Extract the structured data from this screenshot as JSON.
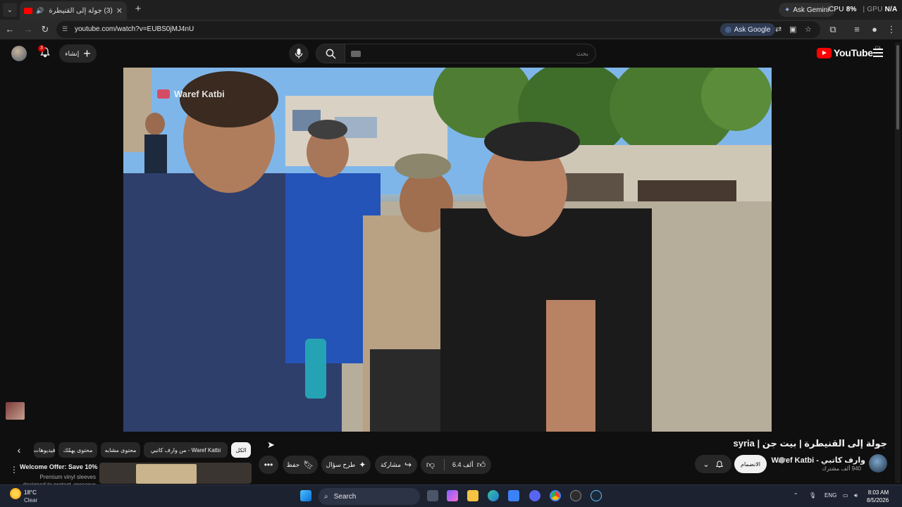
{
  "browser": {
    "tab_title": "(3) جولة إلى القنيطرة | بيت ...",
    "new_tab": "+",
    "ask_gemini": "Ask Gemini",
    "cpu_label": "CPU",
    "cpu_value": "8%",
    "gpu_value": "N/A",
    "url": "youtube.com/watch?v=EUBS0jMJ4nU",
    "ask_google": "Ask Google"
  },
  "youtube": {
    "notification_count": "3",
    "create_label": "إنشاء",
    "search_placeholder": "بحث",
    "logo_text": "YouTube",
    "logo_country": "CA"
  },
  "video": {
    "watermark": "Waref Katbi",
    "title": "جولة إلى القنيطرة | بيت جن | syria",
    "channel_name": "وارف كاتبي - Waref Katbi",
    "subscribers": "940 ألف مشترك",
    "join_label": "الانضمام",
    "likes": "6.4 ألف",
    "share_label": "مشاركة",
    "ask_label": "طرح سؤال",
    "save_label": "حفظ"
  },
  "chips": [
    {
      "label": "الكل",
      "active": true
    },
    {
      "label": "من وارف كاتبي - Waref Katbi",
      "active": false
    },
    {
      "label": "محتوى مشابه",
      "active": false
    },
    {
      "label": "محتوى يهمّك",
      "active": false
    },
    {
      "label": "فيديوهات",
      "active": false
    }
  ],
  "ad": {
    "title": "Welcome Offer: Save 10%",
    "subtitle": "Premium vinyl sleeves designed to protect, preserve"
  },
  "taskbar": {
    "temperature": "18°C",
    "condition": "Clear",
    "search_label": "Search",
    "language": "ENG",
    "time": "8:03 AM",
    "date": "8/5/2026"
  },
  "colors": {
    "youtube_red": "#ff0000",
    "background": "#0f0f0f",
    "pill_bg": "#272727"
  }
}
